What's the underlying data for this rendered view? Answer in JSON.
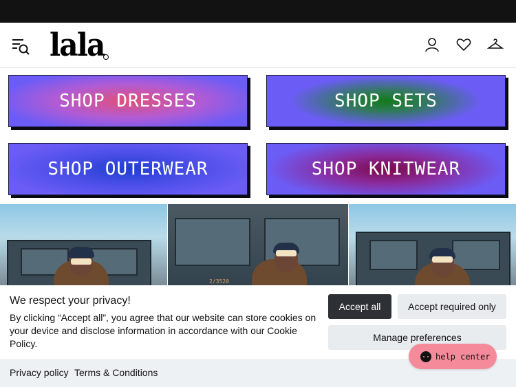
{
  "header": {
    "logo_text": "lala",
    "icons": [
      "menu-search-icon",
      "account-icon",
      "heart-icon",
      "hanger-icon"
    ]
  },
  "tiles": [
    {
      "label": "SHOP DRESSES"
    },
    {
      "label": "SHOP SETS"
    },
    {
      "label": "SHOP OUTERWEAR"
    },
    {
      "label": "SHOP KNITWEAR"
    }
  ],
  "photos": {
    "truck_number": "2/3520"
  },
  "cookie": {
    "title": "We respect your privacy!",
    "text": "By clicking “Accept all”, you agree that our website can store cookies on your device and disclose information in accordance with our Cookie Policy.",
    "accept_all": "Accept all",
    "accept_required": "Accept required only",
    "manage": "Manage preferences"
  },
  "footer": {
    "privacy": "Privacy policy",
    "terms": "Terms & Conditions"
  },
  "help": {
    "label": "help center"
  },
  "colors": {
    "top_bar": "#121212",
    "tile_base": "#6c5cf6",
    "dresses_glow": "#e0507a",
    "sets_glow": "#137a1a",
    "outerwear_glow": "#1f3fcf",
    "knitwear_glow": "#7a0a4a",
    "accept_button": "#2d3136",
    "help_button": "#f58a9a"
  }
}
